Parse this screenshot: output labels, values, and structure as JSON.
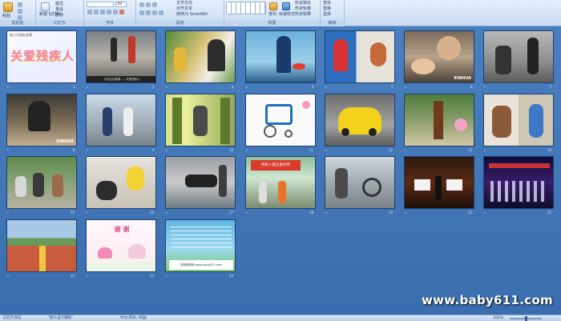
{
  "ribbon": {
    "groups": [
      {
        "id": "clipboard",
        "label": "剪贴板"
      },
      {
        "id": "slides",
        "label": "幻灯片"
      },
      {
        "id": "font",
        "label": "字体"
      },
      {
        "id": "paragraph",
        "label": "段落"
      },
      {
        "id": "drawing",
        "label": "绘图"
      },
      {
        "id": "editing",
        "label": "编辑"
      }
    ],
    "buttons": {
      "paste": "粘贴",
      "new_slide": "新建\n幻灯片",
      "layout": "版式",
      "reset": "重设",
      "delete": "删除",
      "text_direction": "文字方向",
      "align_text": "对齐文本",
      "convert_smartart": "转换为 SmartArt",
      "arrange": "排列",
      "quick_styles": "快速样式",
      "shape_fill": "形状填充",
      "shape_outline": "形状轮廓",
      "shape_effects": "形状效果",
      "find": "查找",
      "replace": "替换",
      "select": "选择",
      "font_size": "32"
    }
  },
  "slides": [
    {
      "num": "1",
      "title": "关爱残疾人",
      "subtitle": "幼儿大班社会课",
      "caption": ""
    },
    {
      "num": "2",
      "caption": "大班社会教案——关爱残疾人"
    },
    {
      "num": "3"
    },
    {
      "num": "4"
    },
    {
      "num": "5"
    },
    {
      "num": "6",
      "caption": "XINHUA"
    },
    {
      "num": "7"
    },
    {
      "num": "8",
      "caption": "XINHUA"
    },
    {
      "num": "9"
    },
    {
      "num": "10"
    },
    {
      "num": "11"
    },
    {
      "num": "12"
    },
    {
      "num": "13"
    },
    {
      "num": "14"
    },
    {
      "num": "15"
    },
    {
      "num": "16"
    },
    {
      "num": "17"
    },
    {
      "num": "18",
      "caption": "残疾人就业服务所"
    },
    {
      "num": "19"
    },
    {
      "num": "20"
    },
    {
      "num": "21"
    },
    {
      "num": "22"
    },
    {
      "num": "23",
      "title": "谢 谢"
    },
    {
      "num": "24",
      "caption": "学前教育网 www.baby611.com"
    }
  ],
  "watermark": "www.baby611.com",
  "statusbar": {
    "slide_view": "幻灯片浏览",
    "theme": "\"默认设计模板\"",
    "language": "中文(简体, 中国)",
    "zoom": "100%"
  },
  "colors": {
    "background": "#3e75b5",
    "ribbon": "#c8dbf2",
    "slide_border": "#1e3f6b"
  }
}
